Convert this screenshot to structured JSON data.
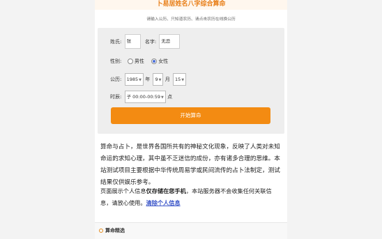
{
  "header": {
    "title": "卜易居姓名八字综合算命",
    "subtitle": "请输入公历、只知道农历、请点击农历在线换公历"
  },
  "form": {
    "surname_label": "姓氏:",
    "surname_value": "张",
    "given_name_label": "名字:",
    "given_name_value": "无忌",
    "gender_label": "性别:",
    "gender_options": [
      "男性",
      "女性"
    ],
    "gender_selected": "女性",
    "date_label": "公历:",
    "year_value": "1985",
    "year_unit": "年",
    "month_value": "9",
    "month_unit": "月",
    "day_value": "15",
    "time_label": "时辰:",
    "time_value": "子 00:00-00:59",
    "time_unit": "点",
    "submit_label": "开始算命"
  },
  "description": {
    "paragraph1": "算命与占卜，是世界各国所共有的神秘文化现象，反映了人类对未知命运的求知心理，其中虽不乏迷信的成份，亦有诸多合理的思维。本站测试项目主要根据中华传统周易学或民间流传的占卜法制定，测试结果仅供娱乐参考。",
    "paragraph2_prefix": "页面展示个人信息",
    "paragraph2_bold": "仅存储在您手机",
    "paragraph2_suffix": "，本站服务器不会收集任何关联信息，请放心使用。",
    "clear_link": "清除个人信息"
  },
  "section": {
    "title": "算命精选"
  },
  "colors": {
    "accent": "#f38b12",
    "title": "#e87d15",
    "link": "#3b56c9"
  }
}
